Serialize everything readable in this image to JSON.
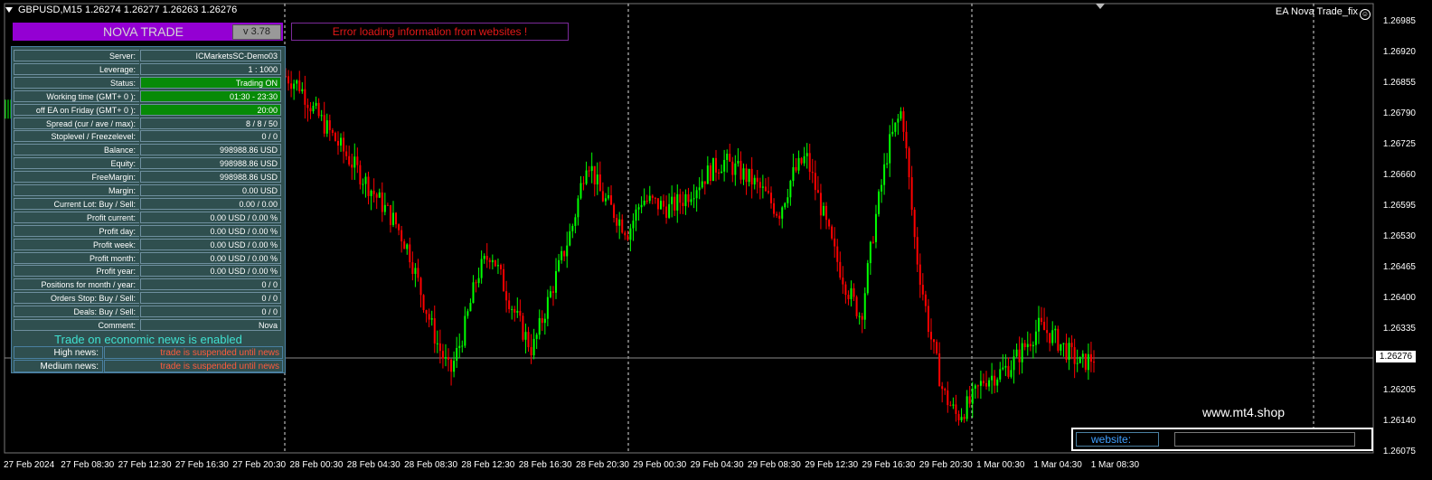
{
  "header": {
    "symbol_line": "GBPUSD,M15  1.26274 1.26277 1.26263 1.26276",
    "ea_label": "EA Nova Trade_fix"
  },
  "nova": {
    "title": "NOVA TRADE",
    "version": "v 3.78",
    "error": "Error loading information from websites !"
  },
  "panel": {
    "rows": [
      {
        "k": "Server:",
        "v": "ICMarketsSC-Demo03"
      },
      {
        "k": "Leverage:",
        "v": "1 : 1000"
      },
      {
        "k": "Status:",
        "v": "Trading ON"
      },
      {
        "k": "Working time (GMT+ 0 ):",
        "v": "01:30 - 23:30"
      },
      {
        "k": "off EA on Friday (GMT+ 0 ):",
        "v": "20:00"
      },
      {
        "k": "Spread (cur / ave / max):",
        "v": "8 / 8 / 50"
      },
      {
        "k": "Stoplevel / Freezelevel:",
        "v": "0 / 0"
      },
      {
        "k": "Balance:",
        "v": "998988.86 USD"
      },
      {
        "k": "Equity:",
        "v": "998988.86 USD"
      },
      {
        "k": "FreeMargin:",
        "v": "998988.86 USD"
      },
      {
        "k": "Margin:",
        "v": "0.00 USD"
      },
      {
        "k": "Current Lot:  Buy  /  Sell:",
        "v": "0.00  /  0.00"
      },
      {
        "k": "Profit current:",
        "v": "0.00 USD / 0.00 %"
      },
      {
        "k": "Profit day:",
        "v": "0.00 USD / 0.00 %"
      },
      {
        "k": "Profit week:",
        "v": "0.00 USD / 0.00 %"
      },
      {
        "k": "Profit month:",
        "v": "0.00 USD / 0.00 %"
      },
      {
        "k": "Profit year:",
        "v": "0.00 USD / 0.00 %"
      },
      {
        "k": "Positions for month / year:",
        "v": "0  /  0"
      },
      {
        "k": "Orders Stop: Buy / Sell:",
        "v": "0  /  0"
      },
      {
        "k": "Deals: Buy / Sell:",
        "v": "0  /  0"
      },
      {
        "k": "Comment:",
        "v": "Nova"
      }
    ],
    "news_header": "Trade on economic news is enabled",
    "news": [
      {
        "k": "High news:",
        "v": "trade is suspended until news"
      },
      {
        "k": "Medium news:",
        "v": "trade is suspended until news"
      }
    ],
    "status_color": "#078a07"
  },
  "website": {
    "watermark": "www.mt4.shop",
    "label": "website:",
    "value": ""
  },
  "chart_data": {
    "type": "candlestick",
    "symbol": "GBPUSD",
    "timeframe": "M15",
    "ylim": [
      1.26075,
      1.26985
    ],
    "y_ticks": [
      "1.26985",
      "1.26920",
      "1.26855",
      "1.26790",
      "1.26725",
      "1.26660",
      "1.26595",
      "1.26530",
      "1.26465",
      "1.26400",
      "1.26335",
      "1.26270",
      "1.26205",
      "1.26140",
      "1.26075"
    ],
    "current_price": "1.26276",
    "x_ticks": [
      "27 Feb 2024",
      "27 Feb 08:30",
      "27 Feb 12:30",
      "27 Feb 16:30",
      "27 Feb 20:30",
      "28 Feb 00:30",
      "28 Feb 04:30",
      "28 Feb 08:30",
      "28 Feb 12:30",
      "28 Feb 16:30",
      "28 Feb 20:30",
      "29 Feb 00:30",
      "29 Feb 04:30",
      "29 Feb 08:30",
      "29 Feb 12:30",
      "29 Feb 16:30",
      "29 Feb 20:30",
      "1 Mar 00:30",
      "1 Mar 04:30",
      "1 Mar 08:30"
    ],
    "close_path": [
      1.2687,
      1.2685,
      1.268,
      1.2676,
      1.2672,
      1.2668,
      1.2664,
      1.266,
      1.2656,
      1.265,
      1.264,
      1.2631,
      1.2624,
      1.2633,
      1.2645,
      1.265,
      1.2642,
      1.2635,
      1.2629,
      1.2638,
      1.2647,
      1.2656,
      1.267,
      1.2662,
      1.2658,
      1.2654,
      1.2661,
      1.266,
      1.2659,
      1.2661,
      1.2664,
      1.2667,
      1.2669,
      1.2667,
      1.2665,
      1.2662,
      1.2658,
      1.2666,
      1.267,
      1.266,
      1.265,
      1.2642,
      1.2636,
      1.2656,
      1.2672,
      1.268,
      1.265,
      1.2633,
      1.262,
      1.2615,
      1.2618,
      1.2623,
      1.2624,
      1.2626,
      1.263,
      1.2634,
      1.2632,
      1.2629,
      1.2626,
      1.26276
    ],
    "colors": {
      "up": "#00ff00",
      "down": "#ff0000",
      "grid": "#ffffff"
    }
  }
}
